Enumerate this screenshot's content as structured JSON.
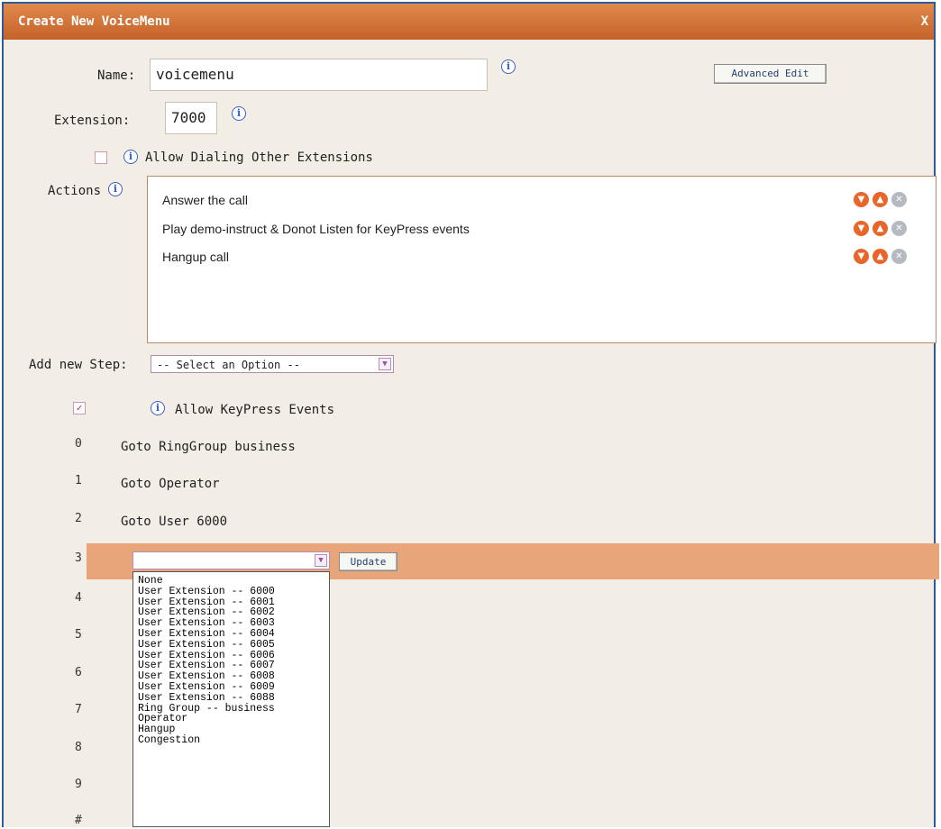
{
  "dialog": {
    "title": "Create New VoiceMenu",
    "close_label": "X"
  },
  "form": {
    "name_label": "Name:",
    "name_value": "voicemenu",
    "advanced_edit_label": "Advanced Edit",
    "extension_label": "Extension:",
    "extension_value": "7000",
    "allow_dialing_label": "Allow Dialing Other Extensions",
    "allow_dialing_checked": false,
    "actions_label": "Actions",
    "actions": [
      {
        "label": "Answer the call"
      },
      {
        "label": "Play demo-instruct & Donot Listen for KeyPress events"
      },
      {
        "label": "Hangup call"
      }
    ],
    "add_step_label": "Add new Step:",
    "add_step_selected": "-- Select an Option --"
  },
  "keypress": {
    "allow_label": "Allow KeyPress Events",
    "allow_checked": true,
    "rows": [
      {
        "key": "0",
        "action": "Goto RingGroup business"
      },
      {
        "key": "1",
        "action": "Goto Operator"
      },
      {
        "key": "2",
        "action": "Goto User 6000"
      },
      {
        "key": "3",
        "action": ""
      },
      {
        "key": "4",
        "action": ""
      },
      {
        "key": "5",
        "action": ""
      },
      {
        "key": "6",
        "action": ""
      },
      {
        "key": "7",
        "action": ""
      },
      {
        "key": "8",
        "action": ""
      },
      {
        "key": "9",
        "action": ""
      },
      {
        "key": "#",
        "action": ""
      }
    ],
    "editing_select_value": "",
    "update_label": "Update",
    "dropdown_options": [
      "None",
      "User Extension -- 6000",
      "User Extension -- 6001",
      "User Extension -- 6002",
      "User Extension -- 6003",
      "User Extension -- 6004",
      "User Extension -- 6005",
      "User Extension -- 6006",
      "User Extension -- 6007",
      "User Extension -- 6008",
      "User Extension -- 6009",
      "User Extension -- 6088",
      "Ring Group -- business",
      "Operator",
      "Hangup",
      "Congestion"
    ]
  },
  "icons": {
    "info": "info-icon",
    "move_down": "chevron-down-icon",
    "move_up": "chevron-up-icon",
    "delete": "close-icon"
  },
  "colors": {
    "titlebar": "#d0743a",
    "highlight_row": "#e8a57a",
    "info_icon": "#3a5ec8",
    "action_icon": "#e8662a",
    "delete_icon": "#b5bac2"
  }
}
